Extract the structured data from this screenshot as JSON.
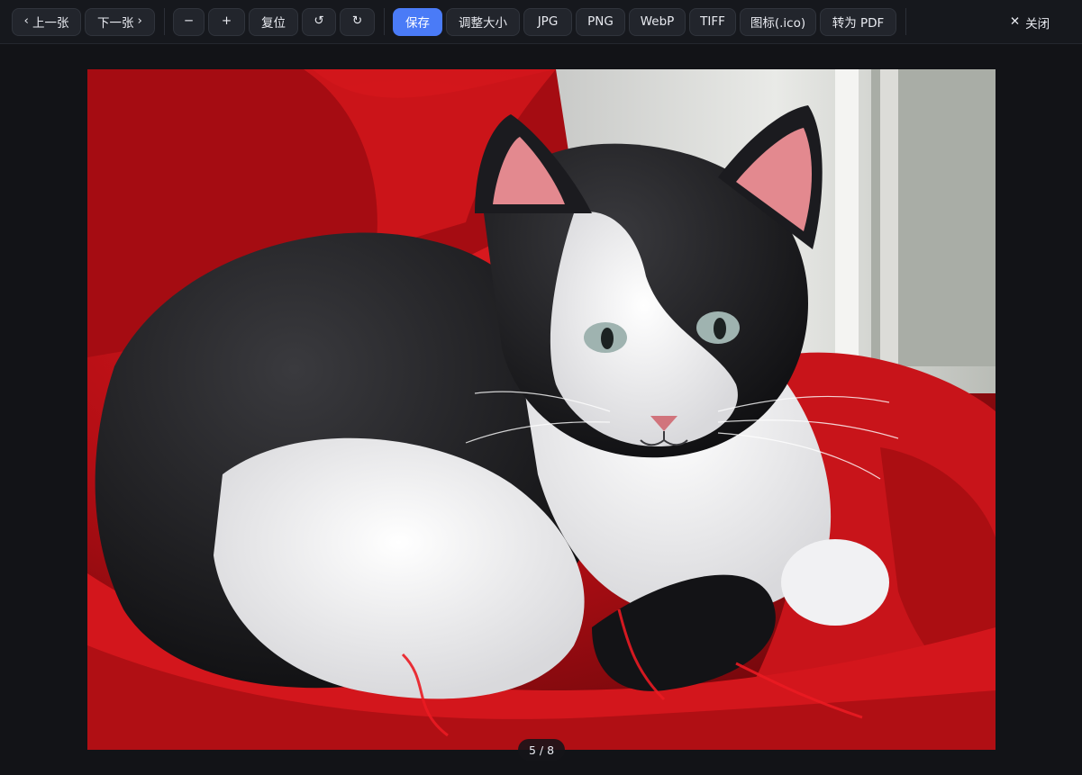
{
  "toolbar": {
    "prev_label": "上一张",
    "next_label": "下一张",
    "zoom_out_label": "−",
    "zoom_in_label": "+",
    "reset_label": "复位",
    "rotate_left_label": "↺",
    "rotate_right_label": "↻",
    "save_label": "保存",
    "resize_label": "调整大小",
    "formats": [
      "JPG",
      "PNG",
      "WebP",
      "TIFF",
      "图标(.ico)",
      "转为 PDF"
    ],
    "close_label": "关闭"
  },
  "viewer": {
    "counter": "5 / 8",
    "current_index": 5,
    "total": 8
  },
  "colors": {
    "accent": "#4a7bf7",
    "background": "#121317",
    "toolbar": "#16181d"
  }
}
